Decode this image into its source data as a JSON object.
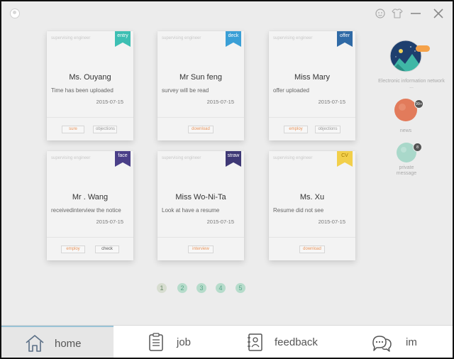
{
  "window": {
    "title_icons": [
      "app-logo-icon",
      "skin-icon",
      "shirt-icon",
      "minimize-icon",
      "close-icon"
    ]
  },
  "cards": [
    {
      "role": "supervising engineer",
      "tag": "entry",
      "tag_color": "#3dbfb3",
      "name": "Ms. Ouyang",
      "status": "Time has been uploaded",
      "date": "2015-07-15",
      "actions": [
        {
          "label": "sure",
          "color": "orange"
        },
        {
          "label": "objections",
          "color": "grey"
        }
      ]
    },
    {
      "role": "supervising engineer",
      "tag": "deck",
      "tag_color": "#3a9fd6",
      "name": "Mr Sun feng",
      "status": "survey will be read",
      "date": "2015-07-15",
      "actions": [
        {
          "label": "download",
          "color": "orange"
        }
      ]
    },
    {
      "role": "supervising engineer",
      "tag": "offer",
      "tag_color": "#2f6aa6",
      "name": "Miss Mary",
      "status": "offer uploaded",
      "date": "2015-07-15",
      "actions": [
        {
          "label": "employ",
          "color": "orange"
        },
        {
          "label": "objections",
          "color": "grey"
        }
      ]
    },
    {
      "role": "supervising engineer",
      "tag": "face",
      "tag_color": "#4a3f88",
      "name": "Mr . Wang",
      "status": "receivedinterview the notice",
      "date": "2015-07-15",
      "actions": [
        {
          "label": "employ",
          "color": "orange"
        },
        {
          "label": "check",
          "color": "dark"
        }
      ]
    },
    {
      "role": "supervising engineer",
      "tag": "straw",
      "tag_color": "#3e3875",
      "name": "Miss Wo-Ni-Ta",
      "status": "Look at have a resume",
      "date": "2015-07-15",
      "actions": [
        {
          "label": "interview",
          "color": "orange"
        }
      ]
    },
    {
      "role": "supervising engineer",
      "tag": "CV",
      "tag_color": "#f2cf4a",
      "tag_text_color": "#a37a00",
      "name": "Ms. Xu",
      "status": "Resume did not see",
      "date": "2015-07-15",
      "actions": [
        {
          "label": "download",
          "color": "orange"
        }
      ]
    }
  ],
  "pagination": {
    "pages": [
      "1",
      "2",
      "3",
      "4",
      "5"
    ],
    "current": "1"
  },
  "sidebar": {
    "profile": {
      "label": "Electronic information network ..."
    },
    "news": {
      "label": "news",
      "badge": "99+"
    },
    "message": {
      "label": "private message",
      "badge": "8"
    }
  },
  "bottom_nav": [
    {
      "label": "home",
      "icon": "home-icon",
      "active": true
    },
    {
      "label": "job",
      "icon": "clipboard-icon",
      "active": false
    },
    {
      "label": "feedback",
      "icon": "contact-book-icon",
      "active": false
    },
    {
      "label": "im",
      "icon": "chat-bubbles-icon",
      "active": false
    }
  ],
  "colors": {
    "accent": "#9ac3d6",
    "background": "#ececec",
    "action_orange": "#e8935a"
  }
}
